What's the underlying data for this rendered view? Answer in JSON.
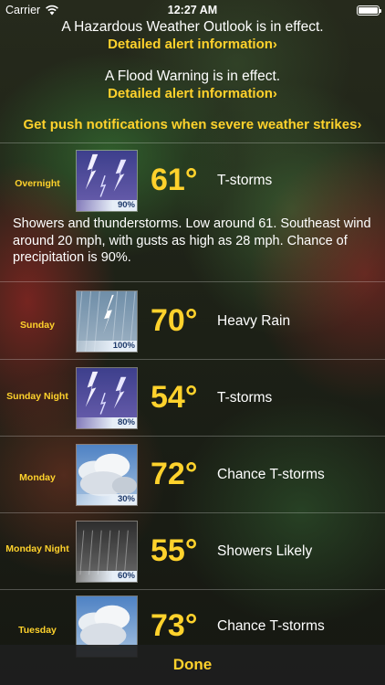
{
  "status_bar": {
    "carrier": "Carrier",
    "time": "12:27 AM"
  },
  "alerts": [
    {
      "text": "A Hazardous Weather Outlook is in effect.",
      "link": "Detailed alert information›"
    },
    {
      "text": "A Flood Warning is in effect.",
      "link": "Detailed alert information›"
    }
  ],
  "push_link": "Get push notifications when severe weather strikes›",
  "forecast": [
    {
      "period": "Overnight",
      "temp": "61°",
      "condition": "T-storms",
      "pop": "90%",
      "icon": "thunderstorm-icon"
    },
    {
      "period": "Sunday",
      "temp": "70°",
      "condition": "Heavy Rain",
      "pop": "100%",
      "icon": "heavy-rain-lightning-icon"
    },
    {
      "period": "Sunday Night",
      "temp": "54°",
      "condition": "T-storms",
      "pop": "80%",
      "icon": "thunderstorm-icon"
    },
    {
      "period": "Monday",
      "temp": "72°",
      "condition": "Chance T-storms",
      "pop": "30%",
      "icon": "chance-thunderstorm-icon"
    },
    {
      "period": "Monday Night",
      "temp": "55°",
      "condition": "Showers Likely",
      "pop": "60%",
      "icon": "showers-icon"
    },
    {
      "period": "Tuesday",
      "temp": "73°",
      "condition": "Chance T-storms",
      "pop": "",
      "icon": "chance-thunderstorm-icon"
    }
  ],
  "detail_text": "Showers and thunderstorms.  Low around 61. Southeast wind around 20 mph, with gusts as high as 28 mph. Chance of precipitation is 90%.",
  "done_label": "Done"
}
